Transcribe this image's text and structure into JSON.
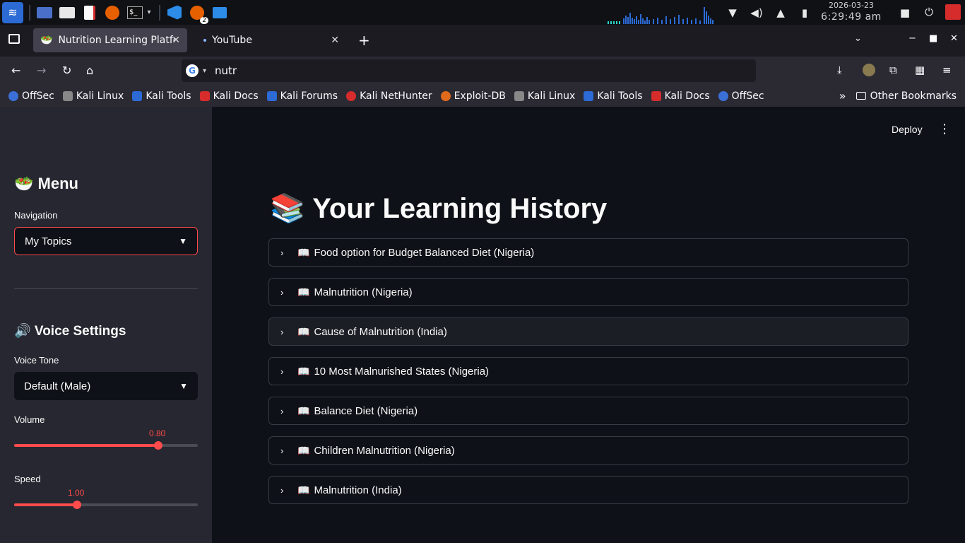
{
  "taskbar": {
    "date": "2026-03-23",
    "time": "6:29:49 am",
    "icons": [
      "kali-menu-icon",
      "workspace-icon",
      "file-manager-icon",
      "text-editor-icon",
      "firefox-icon",
      "terminal-icon",
      "vscode-icon",
      "firefox-badge-icon",
      "folder-icon"
    ],
    "firefox_badge": "2"
  },
  "browser": {
    "tabs": [
      {
        "label": "Nutrition Learning Platform",
        "icon": "salad-icon",
        "active": true
      },
      {
        "label": "YouTube",
        "icon": "dot-icon",
        "active": false
      }
    ],
    "new_tab": "+",
    "url": "nutr",
    "bookmarks": [
      {
        "label": "OffSec",
        "color": "#3b6fd8"
      },
      {
        "label": "Kali Linux",
        "color": "#888888"
      },
      {
        "label": "Kali Tools",
        "color": "#2c6bd6"
      },
      {
        "label": "Kali Docs",
        "color": "#d62c2c"
      },
      {
        "label": "Kali Forums",
        "color": "#2c6bd6"
      },
      {
        "label": "Kali NetHunter",
        "color": "#d62c2c"
      },
      {
        "label": "Exploit-DB",
        "color": "#e06a1b"
      },
      {
        "label": "Kali Linux",
        "color": "#888888"
      },
      {
        "label": "Kali Tools",
        "color": "#2c6bd6"
      },
      {
        "label": "Kali Docs",
        "color": "#d62c2c"
      },
      {
        "label": "OffSec",
        "color": "#3b6fd8"
      }
    ],
    "other_bookmarks": "Other Bookmarks"
  },
  "sidebar": {
    "menu_title": "🥗 Menu",
    "navigation_label": "Navigation",
    "navigation_value": "My Topics",
    "voice_title": "🔊 Voice Settings",
    "voice_tone_label": "Voice Tone",
    "voice_tone_value": "Default (Male)",
    "volume_label": "Volume",
    "volume_value": "0.80",
    "volume_fraction": 0.786,
    "speed_label": "Speed",
    "speed_value": "1.00",
    "speed_fraction": 0.342
  },
  "main": {
    "deploy_label": "Deploy",
    "title": "📚 Your Learning History",
    "topics": [
      "Food option for Budget Balanced Diet (Nigeria)",
      "Malnutrition (Nigeria)",
      "Cause of Malnutrition (India)",
      "10 Most Malnurished States (Nigeria)",
      "Balance Diet (Nigeria)",
      "Children Malnutrition (Nigeria)",
      "Malnutrition (India)"
    ]
  },
  "colors": {
    "accent": "#ff4b4b",
    "sidebar_bg": "#262730",
    "main_bg": "#0e1117"
  }
}
